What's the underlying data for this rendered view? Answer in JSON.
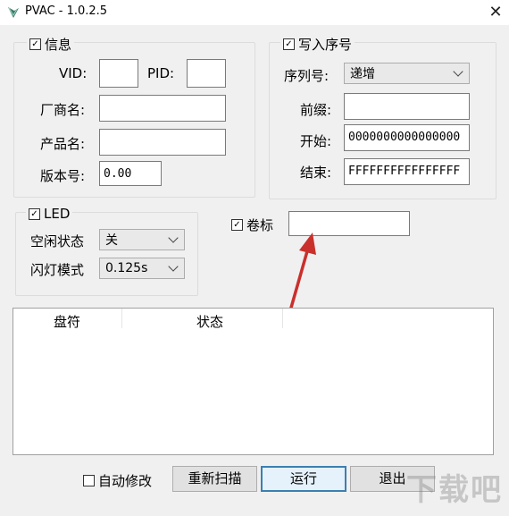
{
  "window": {
    "title": "PVAC - 1.0.2.5",
    "close": "✕"
  },
  "info": {
    "legend": "信息",
    "vid_label": "VID:",
    "vid_value": "",
    "pid_label": "PID:",
    "pid_value": "",
    "vendor_label": "厂商名:",
    "vendor_value": "",
    "product_label": "产品名:",
    "product_value": "",
    "version_label": "版本号:",
    "version_value": "0.00"
  },
  "serial": {
    "legend": "写入序号",
    "seq_label": "序列号:",
    "seq_value": "递增",
    "prefix_label": "前缀:",
    "prefix_value": "",
    "start_label": "开始:",
    "start_value": "0000000000000000",
    "end_label": "结束:",
    "end_value": "FFFFFFFFFFFFFFFF"
  },
  "led": {
    "legend": "LED",
    "idle_label": "空闲状态",
    "idle_value": "关",
    "blink_label": "闪灯模式",
    "blink_value": "0.125s"
  },
  "volume": {
    "label": "卷标",
    "value": ""
  },
  "table": {
    "columns": [
      "盘符",
      "状态"
    ]
  },
  "footer": {
    "auto_modify": "自动修改",
    "rescan": "重新扫描",
    "run": "运行",
    "exit": "退出"
  },
  "watermark": "下载吧"
}
